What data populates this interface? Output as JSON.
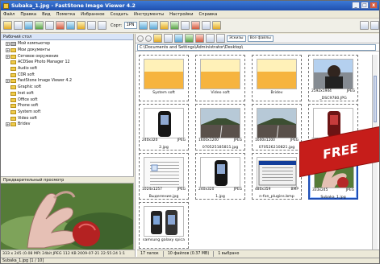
{
  "window": {
    "title": "Subaka_1.jpg - FastStone Image Viewer 4.2",
    "buttons": [
      "_",
      "□",
      "x"
    ]
  },
  "menu": [
    "Файл",
    "Правка",
    "Вид",
    "Пометка",
    "Избранное",
    "Создать",
    "Инструменты",
    "Настройки",
    "Справка"
  ],
  "toolbar": {
    "sort_label": "Сорт:",
    "zoom_value": "1PN",
    "view_mode": "Эскизы",
    "filter_label": "Все файлы"
  },
  "address": {
    "path": "C:\\Documents and Settings\\Administrator\\Desktop\\"
  },
  "sidebar": {
    "header": "Рабочий стол",
    "tree": [
      {
        "label": "Мой компьютер",
        "indent": 1,
        "expand": "+",
        "icon": "drive"
      },
      {
        "label": "Мои документы",
        "indent": 1,
        "expand": "+",
        "icon": "folder"
      },
      {
        "label": "Сетевое окружение",
        "indent": 1,
        "expand": "+",
        "icon": "folder"
      },
      {
        "label": "ACDSee Photo Manager 12",
        "indent": 1,
        "expand": "",
        "icon": "folder"
      },
      {
        "label": "Audio soft",
        "indent": 1,
        "expand": "",
        "icon": "folder"
      },
      {
        "label": "CDR soft",
        "indent": 1,
        "expand": "",
        "icon": "folder"
      },
      {
        "label": "FastStone Image Viewer 4.2",
        "indent": 1,
        "expand": "+",
        "icon": "folder"
      },
      {
        "label": "Graphic soft",
        "indent": 1,
        "expand": "",
        "icon": "folder"
      },
      {
        "label": "Inet soft",
        "indent": 1,
        "expand": "",
        "icon": "folder"
      },
      {
        "label": "Office soft",
        "indent": 1,
        "expand": "",
        "icon": "folder"
      },
      {
        "label": "Phone soft",
        "indent": 1,
        "expand": "",
        "icon": "folder"
      },
      {
        "label": "System soft",
        "indent": 1,
        "expand": "",
        "icon": "folder"
      },
      {
        "label": "Video soft",
        "indent": 1,
        "expand": "",
        "icon": "folder"
      },
      {
        "label": "Bridev",
        "indent": 1,
        "expand": "+",
        "icon": "folder"
      }
    ],
    "preview_label": "Предварительный просмотр",
    "file_meta": "333 x 245 (0.08 MP)  24bit JPEG  112 KB  2009-07-21 22:55:24  1:1"
  },
  "thumbnails": [
    {
      "title": "System soft",
      "dims": "",
      "type": "",
      "thumb": "folder",
      "selected": false
    },
    {
      "title": "Video soft",
      "dims": "",
      "type": "",
      "thumb": "folder",
      "selected": false
    },
    {
      "title": "Bridev",
      "dims": "",
      "type": "",
      "thumb": "folder",
      "selected": false
    },
    {
      "title": "_DSC9780.JPG",
      "dims": "2592x1944",
      "type": "JPEG",
      "thumb": "person",
      "selected": false
    },
    {
      "title": "2.jpg",
      "dims": "240x320",
      "type": "JPEG",
      "thumb": "phone",
      "selected": false
    },
    {
      "title": "070525185811.jpg",
      "dims": "1600x1200",
      "type": "JPEG",
      "thumb": "road",
      "selected": false
    },
    {
      "title": "070526210821.jpg",
      "dims": "1600x1200",
      "type": "JPEG",
      "thumb": "road",
      "selected": false
    },
    {
      "title": "device.bmp",
      "dims": "240x320",
      "type": "BMP",
      "thumb": "redphone",
      "selected": false
    },
    {
      "title": "Выделение.jpg",
      "dims": "1024x1257",
      "type": "JPEG",
      "thumb": "doc",
      "selected": false
    },
    {
      "title": "1.jpg",
      "dims": "240x320",
      "type": "JPEG",
      "thumb": "phone2",
      "selected": false
    },
    {
      "title": "n-fon_plugins.bmp",
      "dims": "480x359",
      "type": "BMP",
      "thumb": "window",
      "selected": false
    },
    {
      "title": "Subaka_1.jpg",
      "dims": "333x245",
      "type": "JPEG",
      "thumb": "hand",
      "selected": true
    },
    {
      "title": "samsung galaxy spica",
      "dims": "",
      "type": "",
      "thumb": "phones",
      "selected": false
    }
  ],
  "status": {
    "folders": "17 папок",
    "files": "10 файлов (0.37 MB)",
    "selected": "1 выбрано"
  },
  "taskbar": "Subaka_1.jpg [1 / 10]",
  "badge": "FREE",
  "colors": {
    "title_blue": "#1f4fae",
    "badge_red": "#c61d1a",
    "selection_blue": "#1f4eb5"
  }
}
